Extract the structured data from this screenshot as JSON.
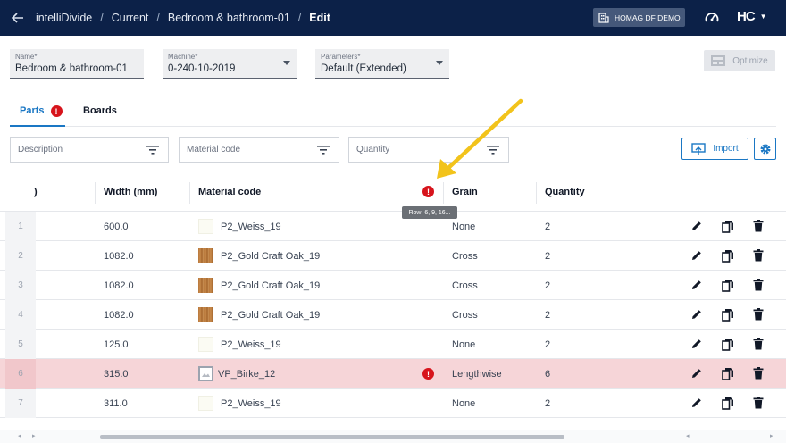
{
  "topbar": {
    "breadcrumbs": [
      "intelliDivide",
      "Current",
      "Bedroom & bathroom-01",
      "Edit"
    ],
    "tenant": "HOMAG DF DEMO",
    "logo": "HC"
  },
  "form": {
    "name": {
      "label": "Name*",
      "value": "Bedroom & bathroom-01"
    },
    "machine": {
      "label": "Machine*",
      "value": "0-240-10-2019"
    },
    "parameters": {
      "label": "Parameters*",
      "value": "Default (Extended)"
    },
    "optimize_label": "Optimize"
  },
  "tabs": [
    {
      "label": "Parts",
      "badge": "!"
    },
    {
      "label": "Boards"
    }
  ],
  "filters": {
    "description": "Description",
    "material_code": "Material code",
    "quantity": "Quantity",
    "import_label": "Import"
  },
  "table": {
    "columns": [
      ")",
      "Width (mm)",
      "Material code",
      "Grain",
      "Quantity"
    ],
    "header_warning": "!",
    "tooltip": "Row: 6, 9, 16...",
    "rows": [
      {
        "num": "1",
        "width": "600.0",
        "material": "P2_Weiss_19",
        "swatch": "weiss",
        "grain": "None",
        "qty": "2",
        "warn": false
      },
      {
        "num": "2",
        "width": "1082.0",
        "material": "P2_Gold Craft Oak_19",
        "swatch": "oak",
        "grain": "Cross",
        "qty": "2",
        "warn": false
      },
      {
        "num": "3",
        "width": "1082.0",
        "material": "P2_Gold Craft Oak_19",
        "swatch": "oak",
        "grain": "Cross",
        "qty": "2",
        "warn": false
      },
      {
        "num": "4",
        "width": "1082.0",
        "material": "P2_Gold Craft Oak_19",
        "swatch": "oak",
        "grain": "Cross",
        "qty": "2",
        "warn": false
      },
      {
        "num": "5",
        "width": "125.0",
        "material": "P2_Weiss_19",
        "swatch": "weiss",
        "grain": "None",
        "qty": "2",
        "warn": false
      },
      {
        "num": "6",
        "width": "315.0",
        "material": "VP_Birke_12",
        "swatch": "image",
        "grain": "Lengthwise",
        "qty": "6",
        "warn": true
      },
      {
        "num": "7",
        "width": "311.0",
        "material": "P2_Weiss_19",
        "swatch": "weiss",
        "grain": "None",
        "qty": "2",
        "warn": false
      }
    ]
  },
  "colors": {
    "primary": "#1a77c4",
    "topbar": "#0c2148",
    "error": "#d7141c",
    "warn_row": "#f6d5d8",
    "annotation": "#f2c31b"
  }
}
